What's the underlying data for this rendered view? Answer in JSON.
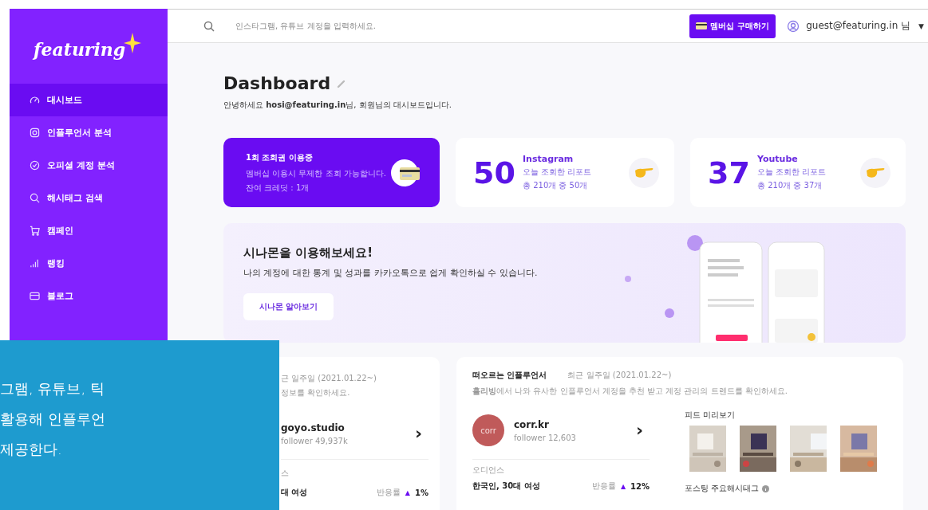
{
  "sidebar": {
    "logo": "featuring",
    "items": [
      {
        "label": "대시보드",
        "kind": "gauge",
        "selected": true
      },
      {
        "label": "인플루언서 분석",
        "kind": "camera",
        "selected": false
      },
      {
        "label": "오피셜 계정 분석",
        "kind": "check",
        "selected": false
      },
      {
        "label": "해시태그 검색",
        "kind": "search",
        "selected": false
      },
      {
        "label": "캠페인",
        "kind": "cart",
        "selected": false
      },
      {
        "label": "랭킹",
        "kind": "bars",
        "selected": false
      },
      {
        "label": "블로그",
        "kind": "card",
        "selected": false
      }
    ]
  },
  "topbar": {
    "search": {
      "placeholder": "인스타그램, 유튜브 계정을 입력하세요."
    },
    "membership_button": "멤버십 구매하기",
    "user": "guest@featuring.in 님",
    "caret": "▼"
  },
  "page": {
    "title": "Dashboard",
    "greeting": "안녕하세요 **hosi@featuring.in**님, 회원님의 대시보드입니다."
  },
  "stat_cards": [
    {
      "kind": "credit",
      "title": "1회 조회권 이용중",
      "line_1": "멤버십 이용시 무제한 조회 가능합니다.",
      "line_2": "잔여 크레딧 : 1개"
    },
    {
      "kind": "count",
      "count": "50",
      "platform": "Instagram",
      "line_1": "오늘 조회한 리포트",
      "line_2": "총 210개 중 50개"
    },
    {
      "kind": "count",
      "count": "37",
      "platform": "Youtube",
      "line_1": "오늘 조회한 리포트",
      "line_2": "총 210개 중 37개"
    }
  ],
  "banner": {
    "title": "시나몬을 이용해보세요!",
    "text": "나의 계정에 대한 통계 및 성과를 카카오톡으로 쉽게 확인하실 수 있습니다.",
    "button": "시나몬 알아보기"
  },
  "partial_card": {
    "period": "근 일주일 (2021.01.22~)",
    "hint": "정보를 확인하세요.",
    "name": "goyo.studio",
    "followers": "follower 49,937k",
    "chevron": "›",
    "audience_label": "스",
    "audience": "대 여성",
    "rate_label": "반응률",
    "trend": "▲",
    "rate": "1%"
  },
  "rising_card": {
    "title": "떠오르는 인플루언서",
    "period": "최근 일주일 (2021.01.22~)",
    "hint": "**홀리빙**에서 나와 유사한 인플루언서 계정을 추천 받고 계정 관리의 트렌드를 확인하세요.",
    "avatar": "corr",
    "name": "corr.kr",
    "followers": "follower 12,603",
    "chevron": "›",
    "audience_label": "오디언스",
    "audience": "한국인, 30대 여성",
    "rate_label": "반응률",
    "trend": "▲",
    "rate": "12%",
    "feed_title": "피드 미리보기",
    "hashtag_title": "포스팅 주요해시태그"
  },
  "overlay": {
    "lines": [
      "그램, 유튜브, 틱",
      "활용해 인플루언",
      "제공한다."
    ]
  }
}
